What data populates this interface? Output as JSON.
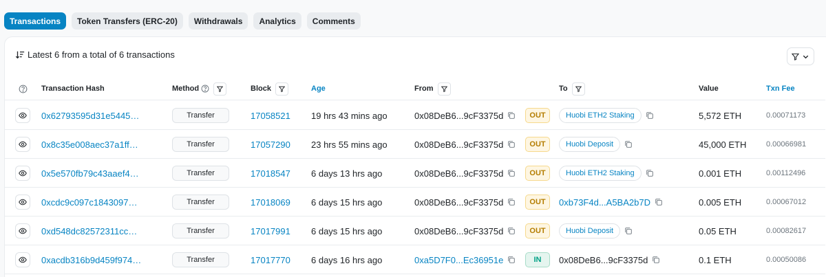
{
  "tabs": [
    {
      "label": "Transactions",
      "active": true
    },
    {
      "label": "Token Transfers (ERC-20)",
      "active": false
    },
    {
      "label": "Withdrawals",
      "active": false
    },
    {
      "label": "Analytics",
      "active": false
    },
    {
      "label": "Comments",
      "active": false
    }
  ],
  "summary": "Latest 6 from a total of 6 transactions",
  "columns": {
    "hash": "Transaction Hash",
    "method": "Method",
    "block": "Block",
    "age": "Age",
    "from": "From",
    "to": "To",
    "value": "Value",
    "fee": "Txn Fee"
  },
  "rows": [
    {
      "hash": "0x62793595d31e5445…",
      "method": "Transfer",
      "block": "17058521",
      "age": "19 hrs 43 mins ago",
      "from": "0x08DeB6...9cF3375d",
      "direction": "OUT",
      "to": "Huobi ETH2 Staking",
      "value": "5,572 ETH",
      "fee": "0.00071173"
    },
    {
      "hash": "0x8c35e008aec37a1ff…",
      "method": "Transfer",
      "block": "17057290",
      "age": "23 hrs 55 mins ago",
      "from": "0x08DeB6...9cF3375d",
      "direction": "OUT",
      "to": "Huobi Deposit",
      "value": "45,000 ETH",
      "fee": "0.00066981"
    },
    {
      "hash": "0x5e570fb79c43aaef4…",
      "method": "Transfer",
      "block": "17018547",
      "age": "6 days 13 hrs ago",
      "from": "0x08DeB6...9cF3375d",
      "direction": "OUT",
      "to": "Huobi ETH2 Staking",
      "value": "0.001 ETH",
      "fee": "0.00112496"
    },
    {
      "hash": "0xcdc9c097c1843097…",
      "method": "Transfer",
      "block": "17018069",
      "age": "6 days 15 hrs ago",
      "from": "0x08DeB6...9cF3375d",
      "direction": "OUT",
      "to": "0xb73F4d...A5BA2b7D",
      "value": "0.005 ETH",
      "fee": "0.00067012"
    },
    {
      "hash": "0xd548dc82572311cc…",
      "method": "Transfer",
      "block": "17017991",
      "age": "6 days 15 hrs ago",
      "from": "0x08DeB6...9cF3375d",
      "direction": "OUT",
      "to": "Huobi Deposit",
      "value": "0.05 ETH",
      "fee": "0.00082617"
    },
    {
      "hash": "0xacdb316b9d459f974…",
      "method": "Transfer",
      "block": "17017770",
      "age": "6 days 16 hrs ago",
      "from": "0xa5D7F0...Ec36951e",
      "direction": "IN",
      "to": "0x08DeB6...9cF3375d",
      "value": "0.1 ETH",
      "fee": "0.00050086"
    }
  ],
  "colors": {
    "accent": "#0784c3",
    "out_badge": "#b47d00",
    "in_badge": "#00a186"
  }
}
